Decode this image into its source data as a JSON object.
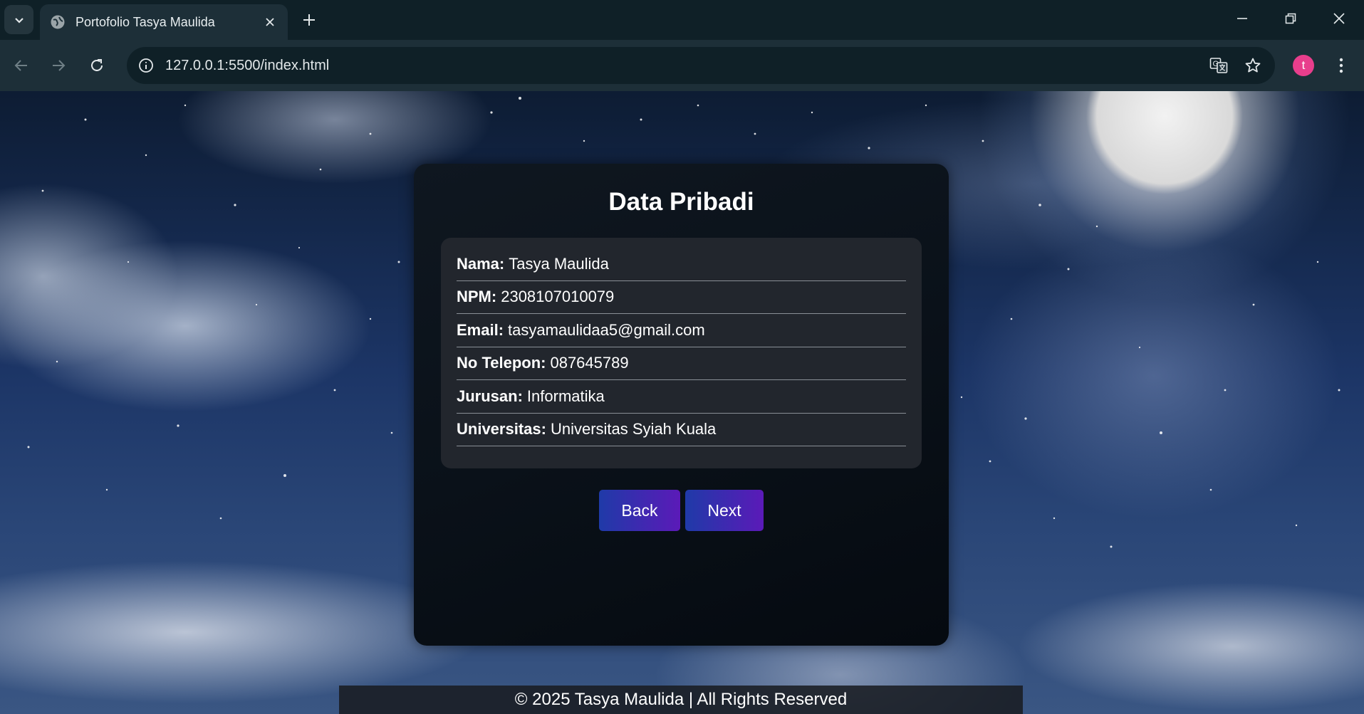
{
  "browser": {
    "tab_title": "Portofolio Tasya Maulida",
    "url": "127.0.0.1:5500/index.html",
    "profile_initial": "t"
  },
  "card": {
    "title": "Data Pribadi",
    "fields": [
      {
        "label": "Nama:",
        "value": "Tasya Maulida"
      },
      {
        "label": "NPM:",
        "value": "2308107010079"
      },
      {
        "label": "Email:",
        "value": "tasyamaulidaa5@gmail.com"
      },
      {
        "label": "No Telepon:",
        "value": "087645789"
      },
      {
        "label": "Jurusan:",
        "value": "Informatika"
      },
      {
        "label": "Universitas:",
        "value": "Universitas Syiah Kuala"
      }
    ],
    "back_label": "Back",
    "next_label": "Next"
  },
  "footer": {
    "text": "© 2025 Tasya Maulida | All Rights Reserved"
  },
  "colors": {
    "accent_gradient_start": "#1f3aa8",
    "accent_gradient_end": "#5b1ab8",
    "profile_avatar": "#e83e8c"
  },
  "icons": [
    "tab-search-icon",
    "globe-icon",
    "close-icon",
    "plus-icon",
    "minimize-icon",
    "restore-icon",
    "window-close-icon",
    "back-arrow-icon",
    "forward-arrow-icon",
    "reload-icon",
    "info-icon",
    "translate-icon",
    "star-icon",
    "more-vert-icon"
  ]
}
